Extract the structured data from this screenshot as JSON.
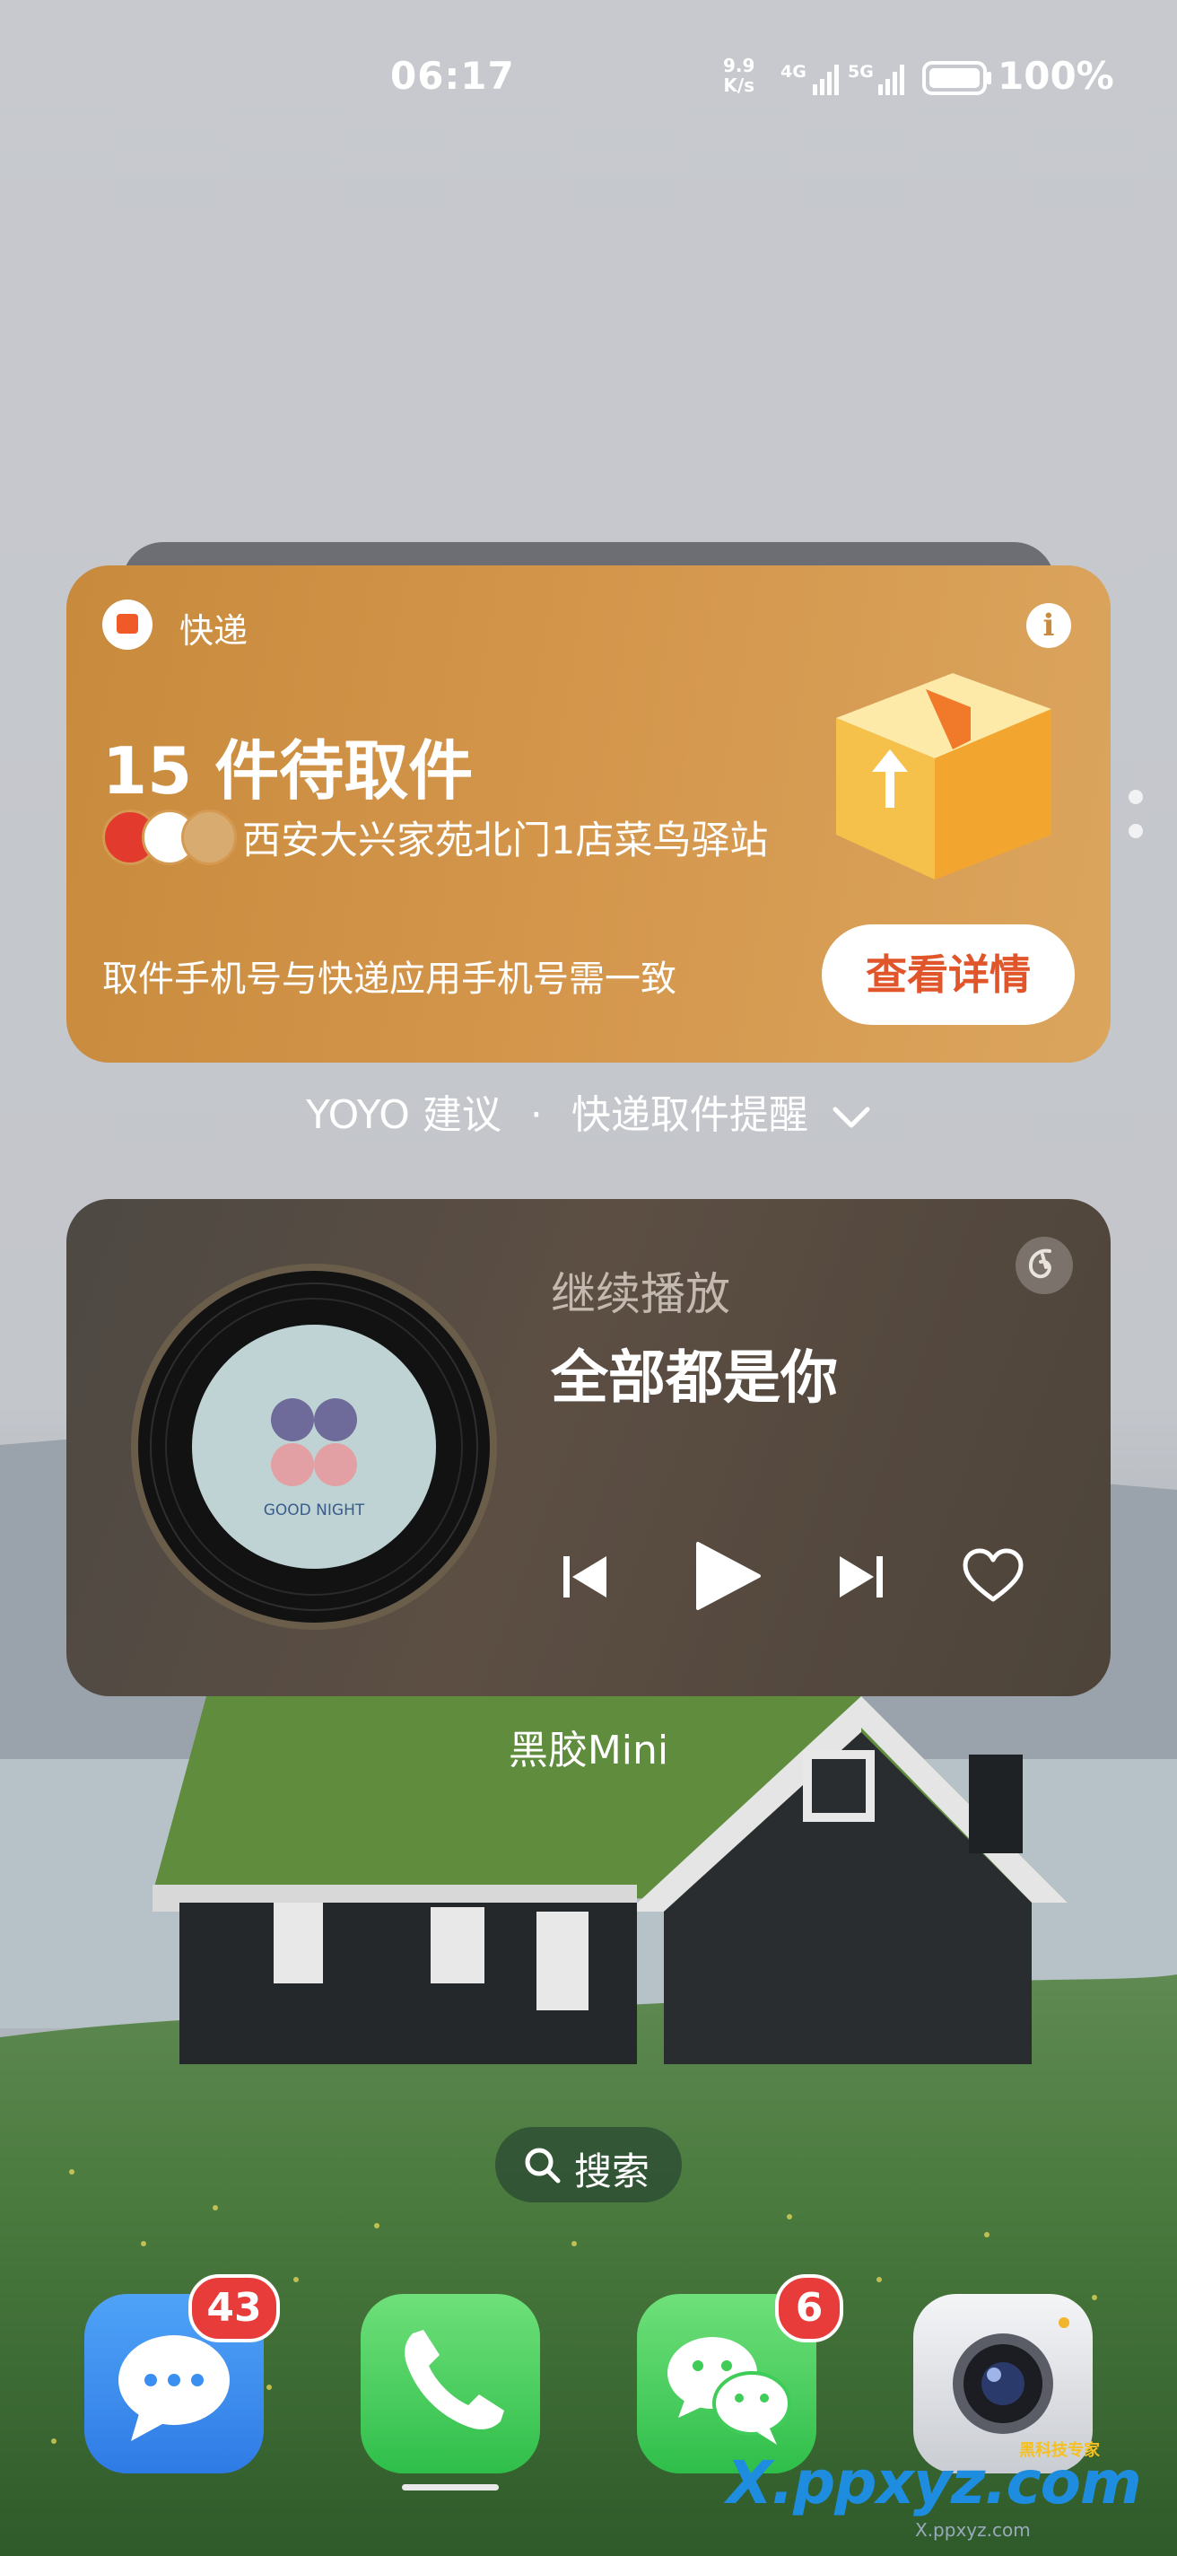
{
  "status_bar": {
    "time": "06:17",
    "net_speed_value": "9.9",
    "net_speed_unit": "K/s",
    "sim1": "4G",
    "sim2": "5G",
    "battery": "100%"
  },
  "express_widget": {
    "app_name": "快递",
    "info_icon": "i",
    "pending_count": "15",
    "pending_label": "件待取件",
    "address": "西安大兴家苑北门1店菜鸟驿站",
    "note": "取件手机号与快递应用手机号需一致",
    "detail_button": "查看详情",
    "accent": "#d3954a"
  },
  "suggestion": {
    "source": "YOYO 建议",
    "separator": "·",
    "title": "快递取件提醒"
  },
  "music_widget": {
    "resume_label": "继续播放",
    "song_title": "全部都是你",
    "album_caption": "GOOD NIGHT"
  },
  "music_widget_name": "黑胶Mini",
  "search": {
    "label": "搜索"
  },
  "dock": {
    "messages_badge": "43",
    "wechat_badge": "6"
  },
  "watermark": {
    "main": "X.ppxyz.com",
    "sub": "X.ppxyz.com",
    "tag": "黑科技专家"
  }
}
